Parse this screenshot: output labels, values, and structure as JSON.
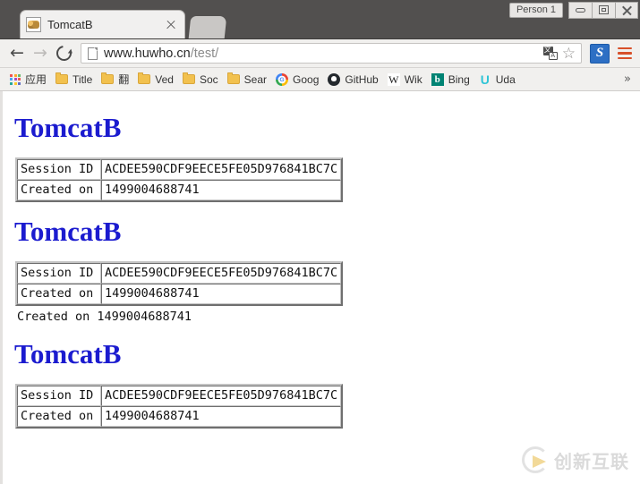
{
  "window": {
    "profile_label": "Person 1",
    "minimize_label": "Minimize",
    "maximize_label": "Maximize",
    "close_label": "Close"
  },
  "tabs": [
    {
      "title": "TomcatB",
      "favicon": "tomcat-cat-icon",
      "close_label": "×"
    }
  ],
  "newtab_label": "+",
  "toolbar": {
    "back_glyph": "←",
    "forward_glyph": "→",
    "reload_label": "Reload",
    "url_host": "www.huwho.cn",
    "url_path": "/test/",
    "url_full": "www.huwho.cn/test/",
    "translate_icon": "translate-icon",
    "translate_glyph_a": "A",
    "star_glyph": "☆",
    "extension_label": "S",
    "menu_label": "Menu"
  },
  "bookmarks": {
    "items": [
      {
        "label": "应用",
        "icon": "apps-grid-icon"
      },
      {
        "label": "Title",
        "icon": "folder-icon"
      },
      {
        "label": "翻",
        "icon": "folder-icon"
      },
      {
        "label": "Ved",
        "icon": "folder-icon"
      },
      {
        "label": "Soc",
        "icon": "folder-icon"
      },
      {
        "label": "Sear",
        "icon": "folder-icon"
      },
      {
        "label": "Goog",
        "icon": "google-icon"
      },
      {
        "label": "GitHub",
        "icon": "github-icon"
      },
      {
        "label": "Wik",
        "icon": "wikipedia-icon"
      },
      {
        "label": "Bing",
        "icon": "bing-icon"
      },
      {
        "label": "Uda",
        "icon": "udacity-icon"
      }
    ],
    "overflow_glyph": "»"
  },
  "page": {
    "blocks": [
      {
        "heading": "TomcatB",
        "rows": [
          {
            "key": "Session ID",
            "value": "ACDEE590CDF9EECE5FE05D976841BC7C"
          },
          {
            "key": "Created on",
            "value": "1499004688741"
          }
        ],
        "extra_line": ""
      },
      {
        "heading": "TomcatB",
        "rows": [
          {
            "key": "Session ID",
            "value": "ACDEE590CDF9EECE5FE05D976841BC7C"
          },
          {
            "key": "Created on",
            "value": "1499004688741"
          }
        ],
        "extra_line": "Created on 1499004688741"
      },
      {
        "heading": "TomcatB",
        "rows": [
          {
            "key": "Session ID",
            "value": "ACDEE590CDF9EECE5FE05D976841BC7C"
          },
          {
            "key": "Created on",
            "value": "1499004688741"
          }
        ],
        "extra_line": ""
      }
    ],
    "watermark_text": "创新互联",
    "heading_color": "#1b1bcf"
  }
}
